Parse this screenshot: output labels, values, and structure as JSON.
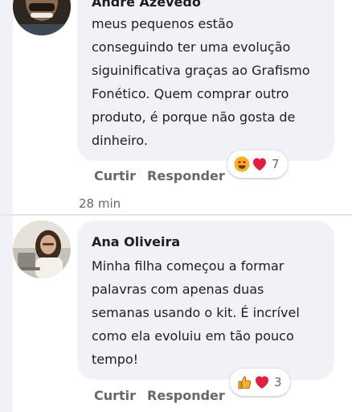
{
  "comments": [
    {
      "author": "André Azevedo",
      "text": "meus pequenos estão\nconseguindo ter uma evolução\nsiguinificativa graças ao Grafismo\nFonético. Quem comprar outro\nproduto, é porque não gosta de\ndinheiro.",
      "reactions": [
        "heart-eyes-icon",
        "heart-icon"
      ],
      "reaction_count": "7",
      "like_label": "Curtir",
      "reply_label": "Responder",
      "time": "28 min"
    },
    {
      "author": "Ana Oliveira",
      "text": "Minha filha começou a formar\npalavras com apenas duas\nsemanas usando o kit. É incrível\ncomo ela evoluiu em tão pouco\ntempo!",
      "reactions": [
        "thumbs-up-icon",
        "heart-icon"
      ],
      "reaction_count": "3",
      "like_label": "Curtir",
      "reply_label": "Responder"
    }
  ],
  "colors": {
    "bubble": "#f0f2f5",
    "secondary_text": "#65676b",
    "heart": "#e41e3f",
    "emoji_yellow": "#f7b125"
  }
}
